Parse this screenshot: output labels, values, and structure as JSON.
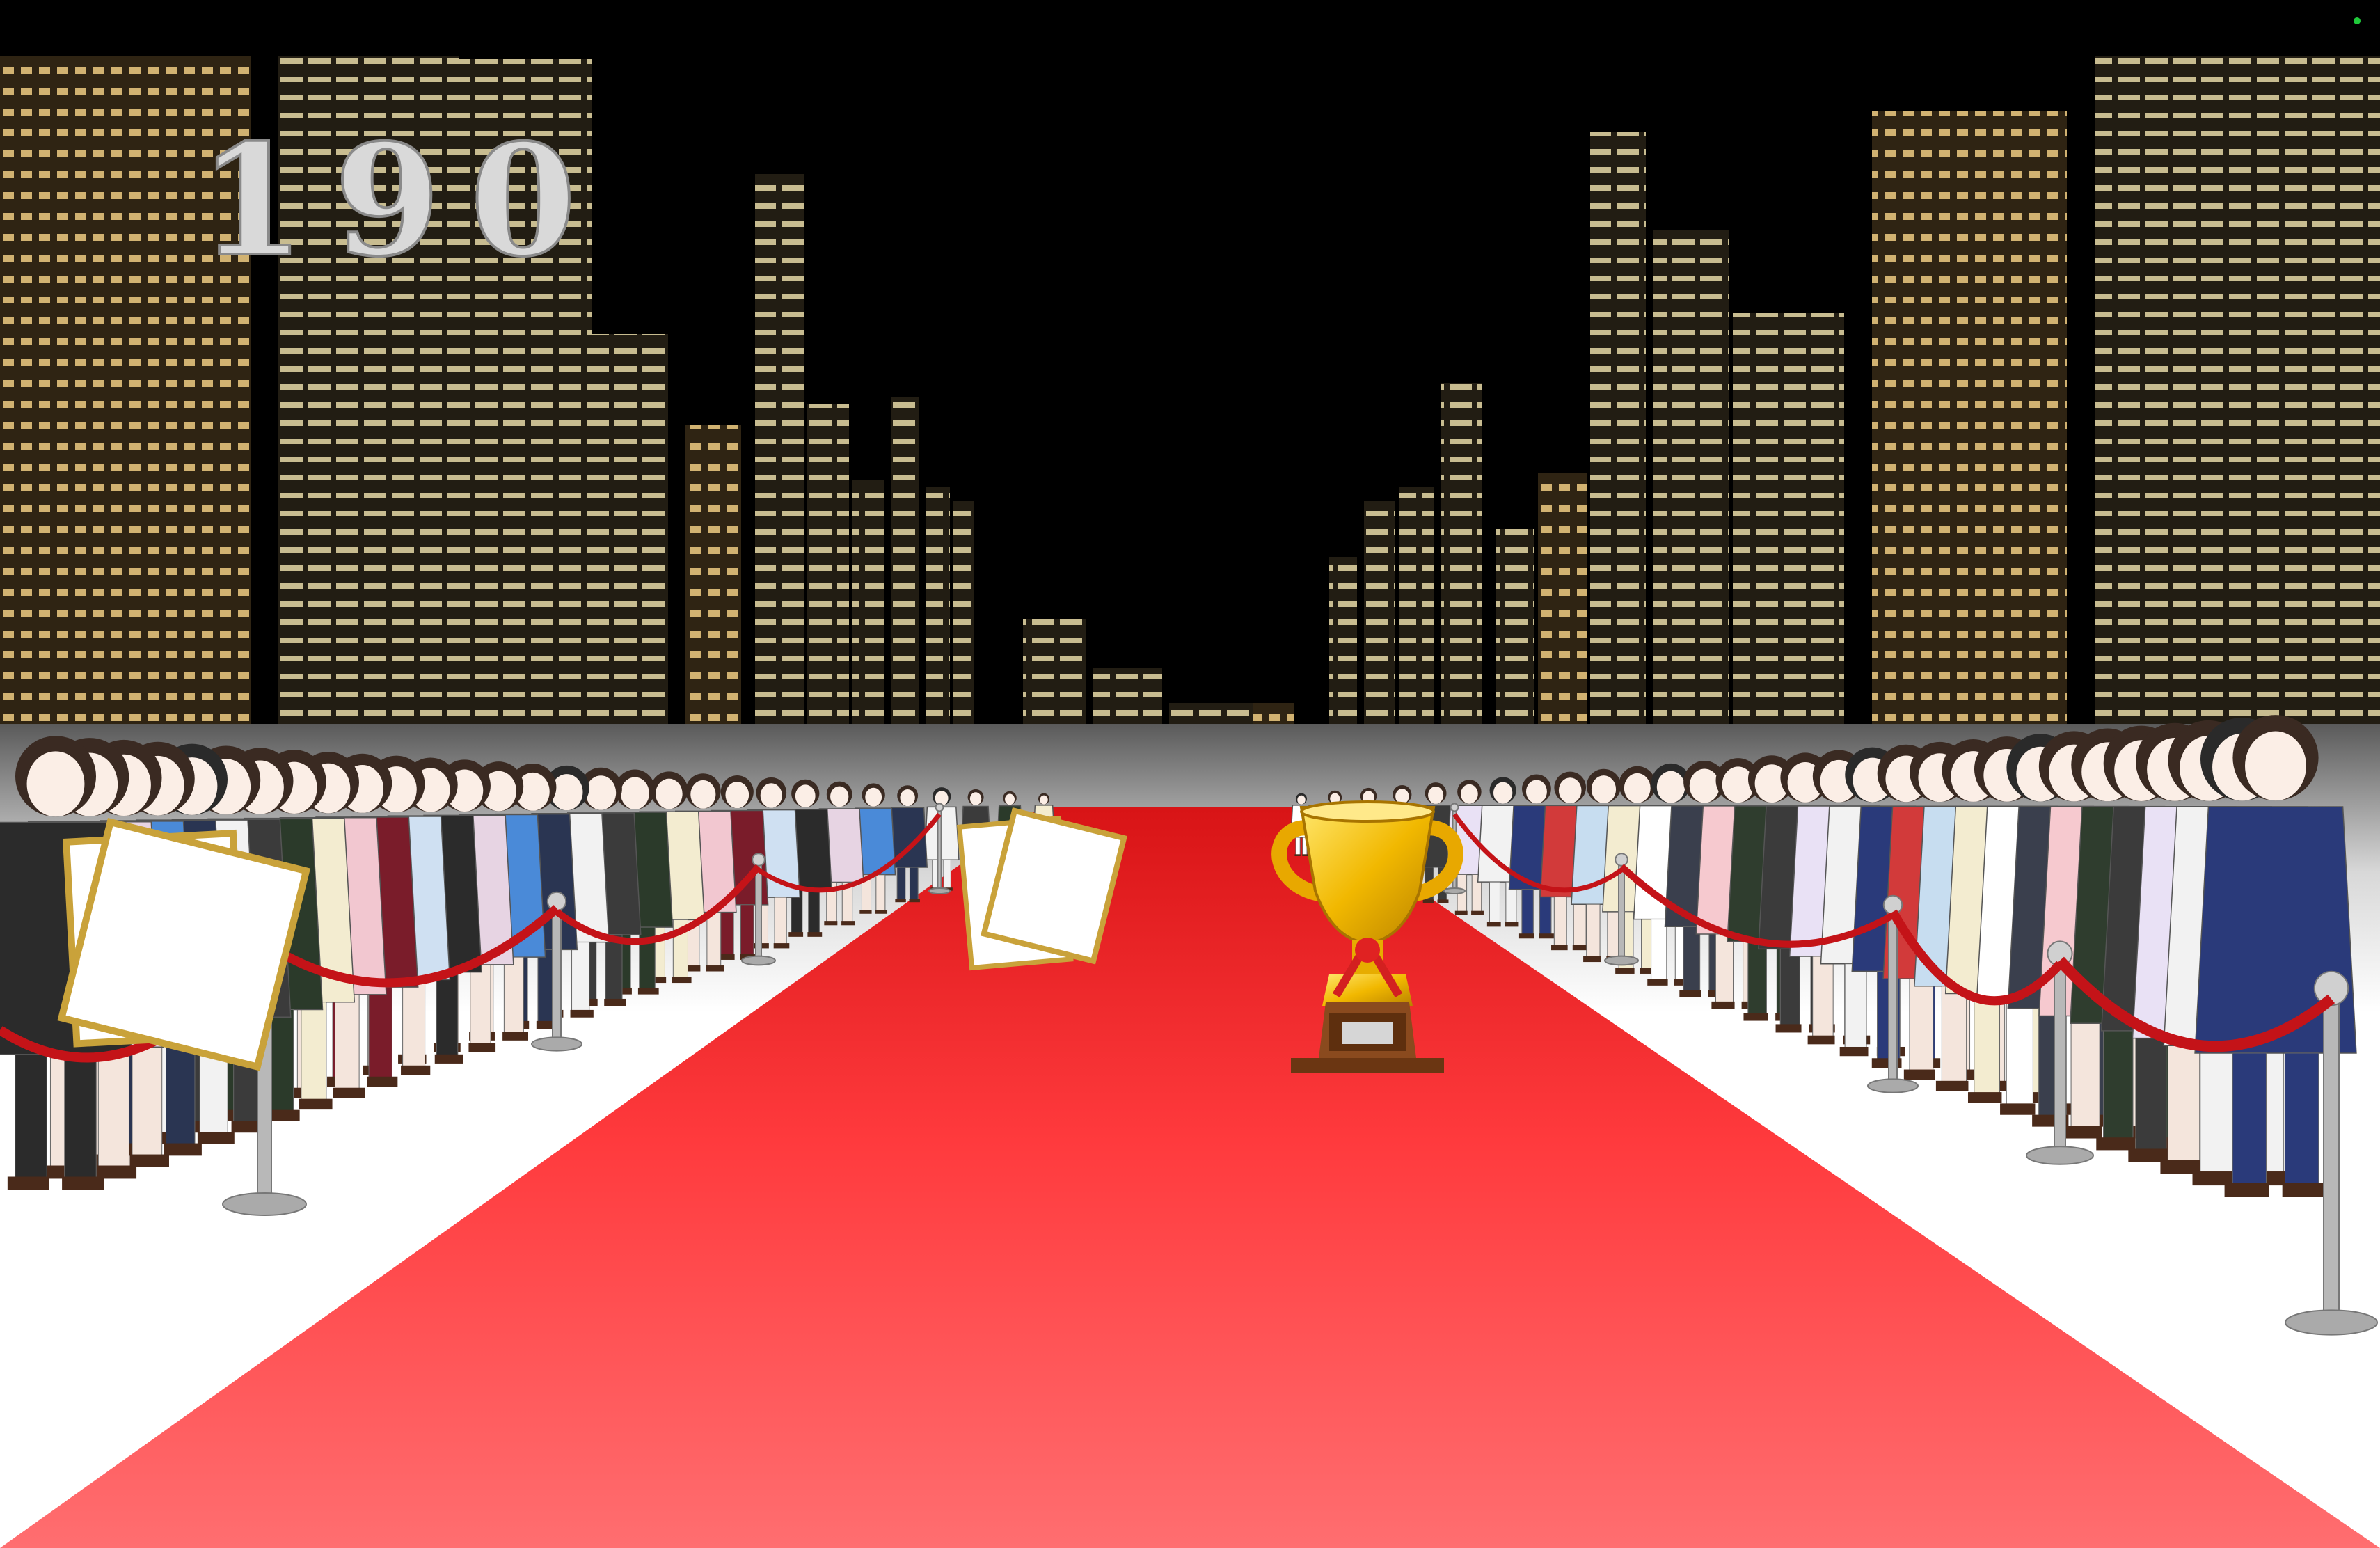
{
  "hud": {
    "score": "190"
  },
  "scene": {
    "sky_color": "#000000",
    "carpet_top_color": "#d81416",
    "carpet_mid_color": "#ff3a3d",
    "carpet_bottom_color": "#ff6e70",
    "floor_color": "#ffffff",
    "building_color": "#3a2c18",
    "window_color": "#ffd98a",
    "rope_color": "#c41318",
    "status_dot_color": "#1fc93a"
  },
  "objects": {
    "trophy": {
      "icon": "trophy-icon"
    },
    "boards": [
      {
        "icon": "shikishi-board-icon"
      },
      {
        "icon": "shikishi-board-icon"
      },
      {
        "icon": "shikishi-board-icon"
      },
      {
        "icon": "shikishi-board-icon"
      }
    ]
  },
  "crowd": {
    "left_outfits": [
      "#f3ecd0",
      "#2b3a2a",
      "#3b3b3b",
      "#f2f2f2",
      "#2a3552",
      "#4a8ad8",
      "#e7d4e3",
      "#2b2b2b",
      "#cfe0f2",
      "#7a1c2a",
      "#f2c7d0"
    ],
    "right_outfits": [
      "#ffffff",
      "#3a3f4d",
      "#f6c9cf",
      "#2f3d2e",
      "#3b3b3b",
      "#e9e1f5",
      "#f2f2f2",
      "#2a3a7a",
      "#d23a3a",
      "#c7ddf0",
      "#f3ecd0"
    ]
  }
}
